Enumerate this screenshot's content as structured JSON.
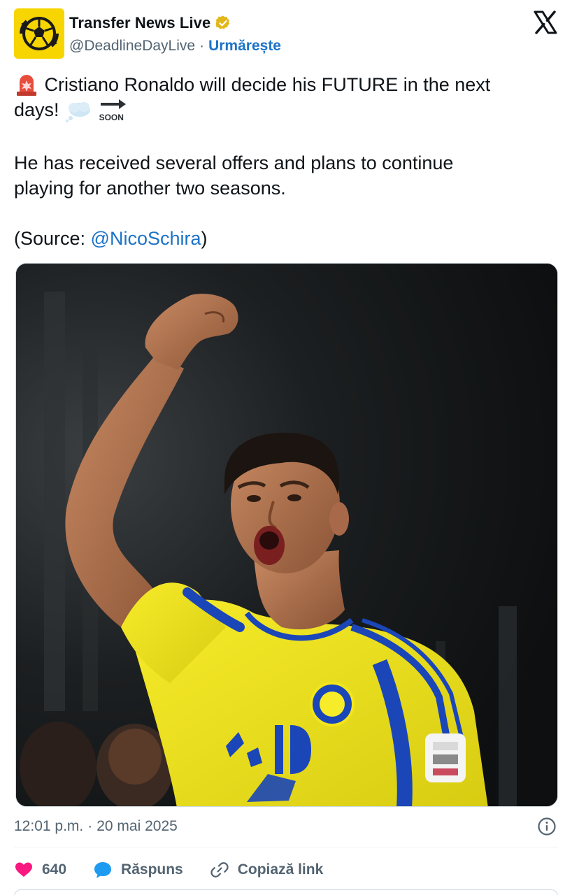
{
  "header": {
    "display_name": "Transfer News Live",
    "handle": "@DeadlineDayLive",
    "separator": "·",
    "follow_label": "Urmărește",
    "icons": {
      "avatar": "football-logo",
      "verified": "gold-verified-badge-icon",
      "platform": "x-logo-icon"
    }
  },
  "tweet": {
    "line1_text": "Cristiano Ronaldo will decide his FUTURE in the next",
    "line2_text": "days!",
    "line1_emoji": "rotating-light-emoji",
    "line2_emojis": [
      "thought-balloon-emoji",
      "soon-arrow-emoji"
    ],
    "soon_label": "SOON",
    "paragraph2_line1": "He has received several offers and plans to continue",
    "paragraph2_line2": "playing for another two seasons.",
    "source_prefix": "(Source: ",
    "source_mention": "@NicoSchira",
    "source_suffix": ")"
  },
  "meta": {
    "time": "12:01 p.m.",
    "separator": "·",
    "date": "20 mai 2025",
    "info_icon": "info-icon"
  },
  "actions": {
    "like_count": "640",
    "reply_label": "Răspuns",
    "copy_link_label": "Copiază link",
    "colors": {
      "like": "#f91880",
      "reply": "#1d9bf0",
      "muted": "#536471"
    }
  },
  "colors": {
    "link": "#1d73c7",
    "avatar_bg": "#f7d500",
    "verified_gold": "#e2b719",
    "jersey": "#f2e51c",
    "jersey_blue": "#1a46b8"
  }
}
